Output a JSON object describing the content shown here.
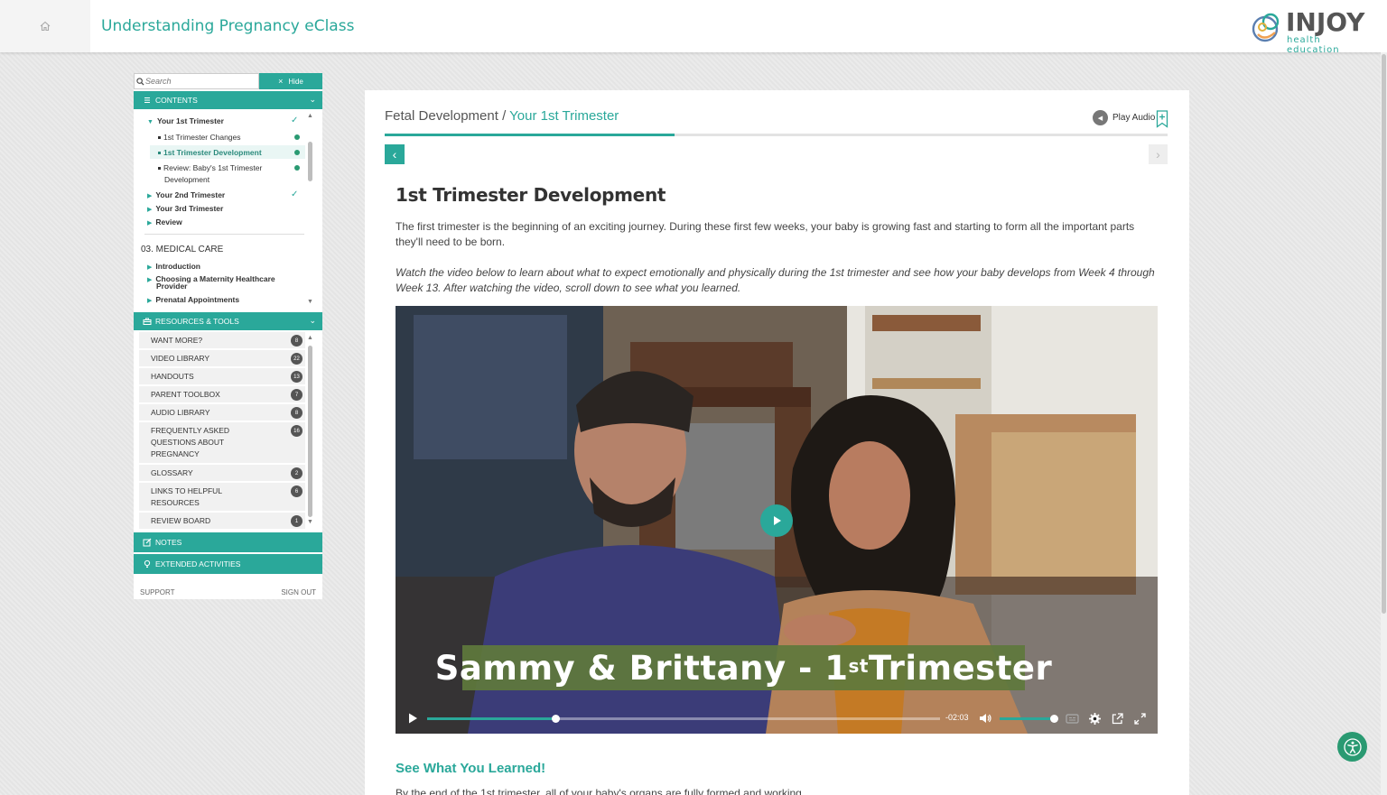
{
  "header": {
    "app_title": "Understanding Pregnancy eClass",
    "logo_word": "INJOY",
    "logo_sub": "health education"
  },
  "sidebar": {
    "search_placeholder": "Search",
    "hide_label": "Hide",
    "contents_label": "CONTENTS",
    "toc": {
      "your_1st": "Your 1st Trimester",
      "changes": "1st Trimester Changes",
      "development": "1st Trimester Development",
      "review_line1": "Review: Baby's 1st Trimester",
      "review_line2": "Development",
      "your_2nd": "Your 2nd Trimester",
      "your_3rd": "Your 3rd Trimester",
      "review": "Review",
      "medical_care": "03. MEDICAL CARE",
      "introduction": "Introduction",
      "choosing_line1": "Choosing a Maternity Healthcare",
      "choosing_line2": "Provider",
      "prenatal": "Prenatal Appointments"
    },
    "resources_label": "RESOURCES & TOOLS",
    "resources": [
      {
        "label": "WANT MORE?",
        "count": "8"
      },
      {
        "label": "VIDEO LIBRARY",
        "count": "22"
      },
      {
        "label": "HANDOUTS",
        "count": "13"
      },
      {
        "label": "PARENT TOOLBOX",
        "count": "7"
      },
      {
        "label": "AUDIO LIBRARY",
        "count": "8"
      },
      {
        "label": "FREQUENTLY ASKED QUESTIONS ABOUT PREGNANCY",
        "count": "16"
      },
      {
        "label": "GLOSSARY",
        "count": "2"
      },
      {
        "label": "LINKS TO HELPFUL RESOURCES",
        "count": "6"
      },
      {
        "label": "REVIEW BOARD",
        "count": "1"
      }
    ],
    "notes_label": "NOTES",
    "extended_label": "EXTENDED ACTIVITIES",
    "support_label": "SUPPORT",
    "signout_label": "SIGN OUT"
  },
  "main": {
    "breadcrumb_parent": "Fetal Development",
    "breadcrumb_sep": " / ",
    "breadcrumb_current": "Your 1st Trimester",
    "progress": 0.37,
    "play_audio_label": "Play Audio",
    "title": "1st Trimester Development",
    "para1": "The first trimester is the beginning of an exciting journey. During these first few weeks, your baby is growing fast and starting to form all the important parts they'll need to be born.",
    "para2": "Watch the video below to learn about what to expect emotionally and physically during the 1st trimester and see how your baby develops from Week 4 through Week 13. After watching the video, scroll down to see what you learned.",
    "video": {
      "caption_main": "Sammy & Brittany - 1",
      "caption_sup": "st",
      "caption_end": " Trimester",
      "time_remaining": "-02:03",
      "played_fraction": 0.25,
      "volume_fraction": 1.0
    },
    "learned_heading": "See What You Learned!",
    "learned_text": "By the end of the 1st trimester, all of your baby's organs are fully formed and working."
  },
  "colors": {
    "accent": "#2aa89a",
    "dot": "#2a9a72"
  }
}
